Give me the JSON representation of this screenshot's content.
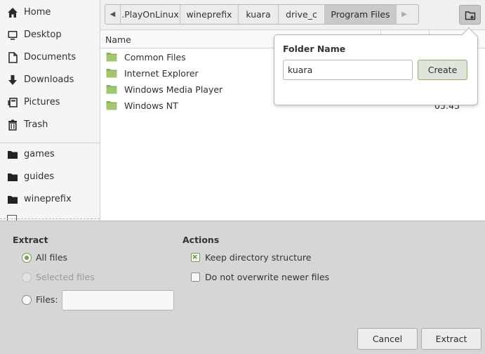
{
  "sidebar": {
    "items": [
      {
        "label": "Home",
        "icon": "home-icon"
      },
      {
        "label": "Desktop",
        "icon": "desktop-icon"
      },
      {
        "label": "Documents",
        "icon": "documents-icon"
      },
      {
        "label": "Downloads",
        "icon": "download-icon"
      },
      {
        "label": "Pictures",
        "icon": "pictures-icon"
      },
      {
        "label": "Trash",
        "icon": "trash-icon"
      }
    ],
    "bookmarks": [
      {
        "label": "games",
        "icon": "folder-icon"
      },
      {
        "label": "guides",
        "icon": "folder-icon"
      },
      {
        "label": "wineprefix",
        "icon": "folder-icon"
      }
    ]
  },
  "breadcrumb": {
    "items": [
      ".PlayOnLinux",
      "wineprefix",
      "kuara",
      "drive_c",
      "Program Files"
    ],
    "active_index": 4
  },
  "filelist": {
    "column_name": "Name",
    "rows": [
      {
        "name": "Common Files",
        "time": ""
      },
      {
        "name": "Internet Explorer",
        "time": ""
      },
      {
        "name": "Windows Media Player",
        "time": ""
      },
      {
        "name": "Windows NT",
        "time": "05:45"
      }
    ]
  },
  "new_folder_popover": {
    "title": "Folder Name",
    "value": "kuara",
    "create_label": "Create"
  },
  "extract": {
    "title": "Extract",
    "all_files": "All files",
    "selected_files": "Selected files",
    "files_label": "Files:",
    "files_value": ""
  },
  "actions": {
    "title": "Actions",
    "keep_structure": "Keep directory structure",
    "keep_structure_checked": true,
    "no_overwrite": "Do not overwrite newer files",
    "no_overwrite_checked": false
  },
  "buttons": {
    "cancel": "Cancel",
    "extract": "Extract"
  },
  "colors": {
    "accent": "#7d9b5a",
    "folder": "#8fb25c",
    "active_crumb": "#c9c9c9"
  }
}
